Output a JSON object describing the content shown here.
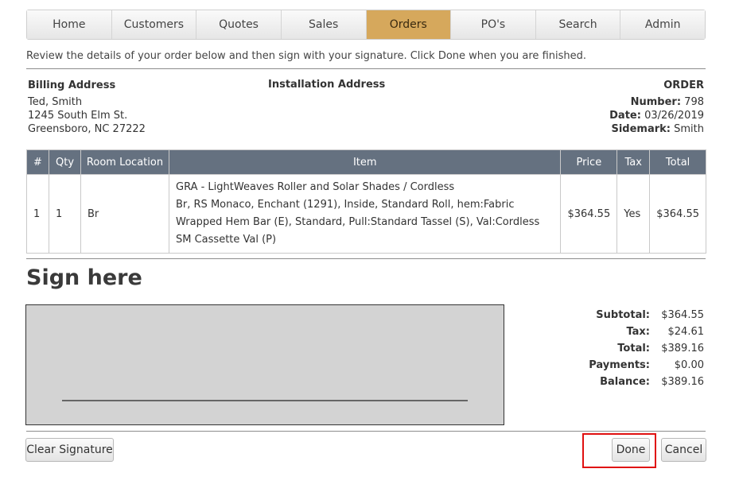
{
  "nav": {
    "items": [
      "Home",
      "Customers",
      "Quotes",
      "Sales",
      "Orders",
      "PO's",
      "Search",
      "Admin"
    ],
    "active": "Orders"
  },
  "intro": "Review the details of your order below and then sign with your signature. Click Done when you are finished.",
  "billing": {
    "label": "Billing Address",
    "name": "Ted, Smith",
    "street": "1245 South Elm St.",
    "city": "Greensboro, NC 27222"
  },
  "installation": {
    "label": "Installation Address"
  },
  "order": {
    "label": "ORDER",
    "number_label": "Number:",
    "number": "798",
    "date_label": "Date:",
    "date": "03/26/2019",
    "sidemark_label": "Sidemark:",
    "sidemark": "Smith"
  },
  "table": {
    "headers": [
      "#",
      "Qty",
      "Room Location",
      "Item",
      "Price",
      "Tax",
      "Total"
    ],
    "rows": [
      {
        "num": "1",
        "qty": "1",
        "room": "Br",
        "item_line1": "GRA - LightWeaves Roller and Solar Shades / Cordless",
        "item_line2": "Br, RS Monaco, Enchant (1291), Inside, Standard Roll, hem:Fabric Wrapped Hem Bar (E), Standard, Pull:Standard Tassel (S), Val:Cordless SM Cassette Val (P)",
        "price": "$364.55",
        "tax": "Yes",
        "total": "$364.55"
      }
    ]
  },
  "sign": {
    "title": "Sign here"
  },
  "totals": {
    "subtotal_label": "Subtotal:",
    "subtotal": "$364.55",
    "tax_label": "Tax:",
    "tax": "$24.61",
    "total_label": "Total:",
    "total": "$389.16",
    "payments_label": "Payments:",
    "payments": "$0.00",
    "balance_label": "Balance:",
    "balance": "$389.16"
  },
  "buttons": {
    "clear": "Clear Signature",
    "done": "Done",
    "cancel": "Cancel"
  },
  "colors": {
    "nav_active": "#d6a85c",
    "table_header": "#657180",
    "highlight": "#e01010"
  }
}
